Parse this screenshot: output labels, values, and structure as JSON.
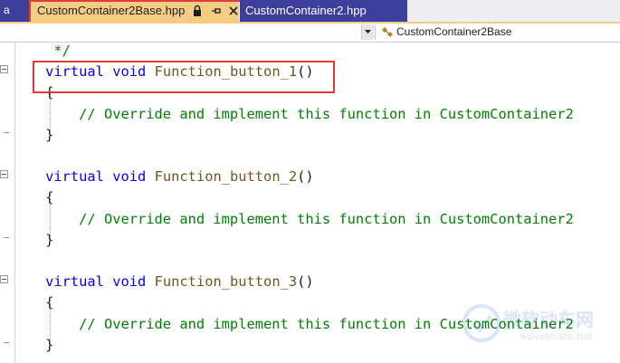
{
  "tabs": {
    "left_stub": "a",
    "active": {
      "label": "CustomContainer2Base.hpp",
      "lock_icon": "lock-icon",
      "pin_icon": "pin-icon",
      "close_icon": "close-icon"
    },
    "inactive": {
      "label": "CustomContainer2.hpp"
    }
  },
  "navbar": {
    "scope_value": "",
    "member_icon": "class-member-icon",
    "member_label": "CustomContainer2Base"
  },
  "code": {
    "lines": [
      {
        "indent": "     ",
        "tokens": [
          {
            "t": "*/",
            "c": "cm"
          }
        ]
      },
      {
        "indent": "    ",
        "tokens": [
          {
            "t": "virtual",
            "c": "kw"
          },
          {
            "t": " ",
            "c": "pl"
          },
          {
            "t": "void",
            "c": "kw"
          },
          {
            "t": " ",
            "c": "pl"
          },
          {
            "t": "Function_button_1",
            "c": "fn"
          },
          {
            "t": "()",
            "c": "pl"
          }
        ]
      },
      {
        "indent": "    ",
        "tokens": [
          {
            "t": "{",
            "c": "pl"
          }
        ]
      },
      {
        "indent": "        ",
        "tokens": [
          {
            "t": "// Override and implement this function in CustomContainer2",
            "c": "cm"
          }
        ]
      },
      {
        "indent": "    ",
        "tokens": [
          {
            "t": "}",
            "c": "pl"
          }
        ]
      },
      {
        "indent": "",
        "tokens": []
      },
      {
        "indent": "    ",
        "tokens": [
          {
            "t": "virtual",
            "c": "kw"
          },
          {
            "t": " ",
            "c": "pl"
          },
          {
            "t": "void",
            "c": "kw"
          },
          {
            "t": " ",
            "c": "pl"
          },
          {
            "t": "Function_button_2",
            "c": "fn"
          },
          {
            "t": "()",
            "c": "pl"
          }
        ]
      },
      {
        "indent": "    ",
        "tokens": [
          {
            "t": "{",
            "c": "pl"
          }
        ]
      },
      {
        "indent": "        ",
        "tokens": [
          {
            "t": "// Override and implement this function in CustomContainer2",
            "c": "cm"
          }
        ]
      },
      {
        "indent": "    ",
        "tokens": [
          {
            "t": "}",
            "c": "pl"
          }
        ]
      },
      {
        "indent": "",
        "tokens": []
      },
      {
        "indent": "    ",
        "tokens": [
          {
            "t": "virtual",
            "c": "kw"
          },
          {
            "t": " ",
            "c": "pl"
          },
          {
            "t": "void",
            "c": "kw"
          },
          {
            "t": " ",
            "c": "pl"
          },
          {
            "t": "Function_button_3",
            "c": "fn"
          },
          {
            "t": "()",
            "c": "pl"
          }
        ]
      },
      {
        "indent": "    ",
        "tokens": [
          {
            "t": "{",
            "c": "pl"
          }
        ]
      },
      {
        "indent": "        ",
        "tokens": [
          {
            "t": "// Override and implement this function in CustomContainer2",
            "c": "cm"
          }
        ]
      },
      {
        "indent": "    ",
        "tokens": [
          {
            "t": "}",
            "c": "pl"
          }
        ]
      }
    ]
  },
  "watermark": {
    "main": "微软动车网",
    "sub": "waveshare.net"
  },
  "colors": {
    "tab_active_bg": "#f5cc84",
    "tab_inactive_bg": "#3e3e9e",
    "highlight_red": "#e03a3a",
    "keyword": "#0000ff",
    "function_name": "#74531f",
    "comment": "#008000"
  }
}
